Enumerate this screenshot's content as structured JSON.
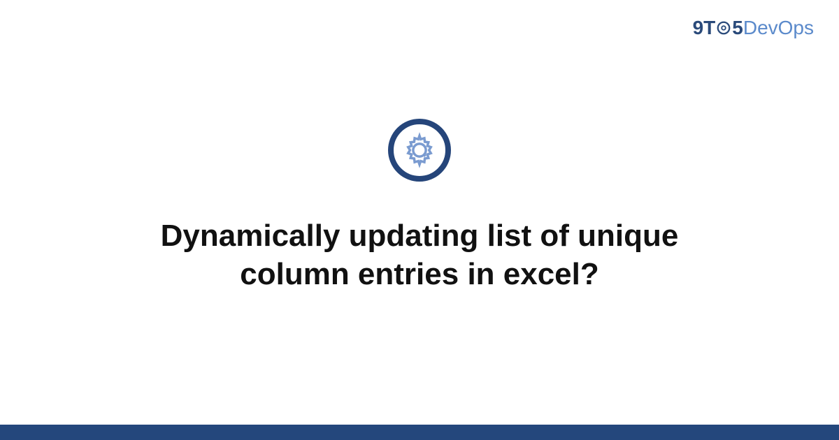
{
  "logo": {
    "nine": "9",
    "t": "T",
    "five": "5",
    "dev": "Dev",
    "ops": "Ops"
  },
  "title": "Dynamically updating list of unique column entries in excel?",
  "colors": {
    "darkBlue": "#25457a",
    "lightBlue": "#5b8acb",
    "footer": "#24477c"
  }
}
